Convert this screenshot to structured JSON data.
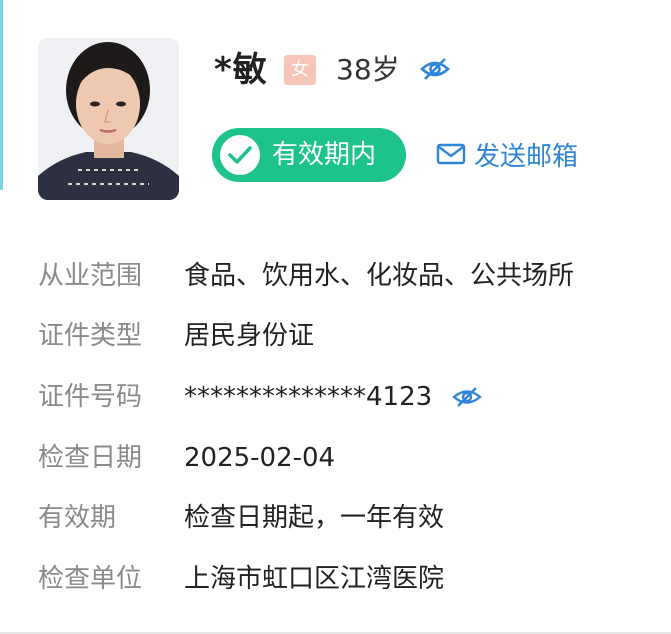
{
  "profile": {
    "name": "*敏",
    "gender": "女",
    "age": "38岁",
    "photo_icon": "person-photo",
    "eye_icon": "eye-hidden-icon"
  },
  "status": {
    "badge_label": "有效期内",
    "badge_color": "#1ec28b",
    "check_icon": "check-icon"
  },
  "actions": {
    "send_mail_label": "发送邮箱",
    "mail_icon": "mail-icon",
    "accent_color": "#2f86d6"
  },
  "details": {
    "scope": {
      "label": "从业范围",
      "value": "食品、饮用水、化妆品、公共场所"
    },
    "id_type": {
      "label": "证件类型",
      "value": "居民身份证"
    },
    "id_number": {
      "label": "证件号码",
      "value": "**************4123"
    },
    "check_date": {
      "label": "检查日期",
      "value": "2025-02-04"
    },
    "validity": {
      "label": "有效期",
      "value": "检查日期起，一年有效"
    },
    "check_unit": {
      "label": "检查单位",
      "value": "上海市虹口区江湾医院"
    }
  }
}
